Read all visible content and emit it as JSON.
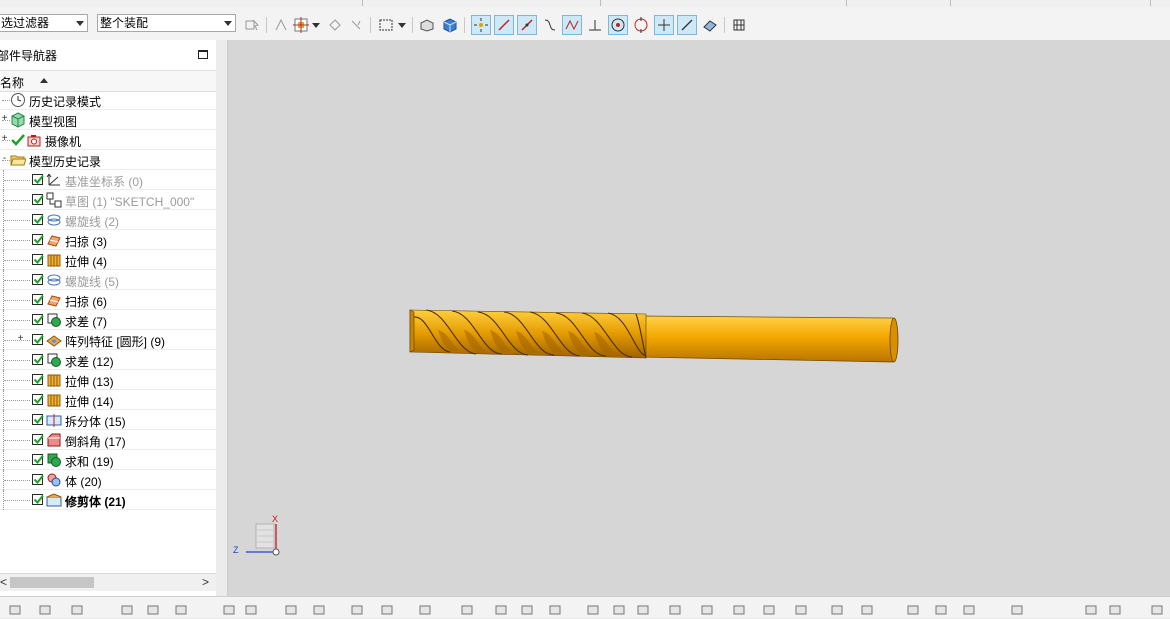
{
  "toolbar": {
    "filter_value": "选过滤器",
    "scope_value": "整个装配",
    "icons": [
      "selection-options-icon",
      "snap-point-icon",
      "dropdown-icon",
      "show-hide-icon",
      "more-icon",
      "select-box-icon",
      "dropdown-icon",
      "shaded-view-icon",
      "solid-view-icon",
      "snap-endpoint-icon",
      "snap-midpoint-icon",
      "snap-control-icon",
      "snap-curve-icon",
      "snap-intersection-icon",
      "snap-perpendicular-icon",
      "snap-center-icon",
      "snap-quadrant-icon",
      "snap-existing-point-icon",
      "snap-on-curve-icon",
      "snap-surface-icon",
      "snap-grid-icon"
    ]
  },
  "navigator": {
    "title": "部件导航器",
    "column_name": "名称",
    "items": [
      {
        "label": "历史记录模式",
        "icon": "clock-icon",
        "level": 0,
        "expander": "",
        "checked": null,
        "dim": false,
        "bold": false
      },
      {
        "label": "模型视图",
        "icon": "model-views-icon",
        "level": 0,
        "expander": "+",
        "checked": null,
        "dim": false,
        "bold": false
      },
      {
        "label": "摄像机",
        "icon": "camera-icon",
        "level": 0,
        "expander": "+",
        "checked": "green",
        "dim": false,
        "bold": false
      },
      {
        "label": "模型历史记录",
        "icon": "folder-open-icon",
        "level": 0,
        "expander": "-",
        "checked": null,
        "dim": false,
        "bold": false
      },
      {
        "label": "基准坐标系 (0)",
        "icon": "datum-csys-icon",
        "level": 1,
        "expander": "",
        "checked": "box",
        "dim": true,
        "bold": false
      },
      {
        "label": "草图 (1) \"SKETCH_000\"",
        "icon": "sketch-icon",
        "level": 1,
        "expander": "",
        "checked": "box",
        "dim": true,
        "bold": false
      },
      {
        "label": "螺旋线 (2)",
        "icon": "helix-icon",
        "level": 1,
        "expander": "",
        "checked": "box",
        "dim": true,
        "bold": false
      },
      {
        "label": "扫掠 (3)",
        "icon": "swept-icon",
        "level": 1,
        "expander": "",
        "checked": "box",
        "dim": false,
        "bold": false
      },
      {
        "label": "拉伸 (4)",
        "icon": "extrude-icon",
        "level": 1,
        "expander": "",
        "checked": "box",
        "dim": false,
        "bold": false
      },
      {
        "label": "螺旋线 (5)",
        "icon": "helix-icon",
        "level": 1,
        "expander": "",
        "checked": "box",
        "dim": true,
        "bold": false
      },
      {
        "label": "扫掠 (6)",
        "icon": "swept-icon",
        "level": 1,
        "expander": "",
        "checked": "box",
        "dim": false,
        "bold": false
      },
      {
        "label": "求差 (7)",
        "icon": "subtract-icon",
        "level": 1,
        "expander": "",
        "checked": "box",
        "dim": false,
        "bold": false
      },
      {
        "label": "阵列特征 [圆形] (9)",
        "icon": "pattern-feature-icon",
        "level": 1,
        "expander": "+",
        "checked": "box",
        "dim": false,
        "bold": false
      },
      {
        "label": "求差 (12)",
        "icon": "subtract-icon",
        "level": 1,
        "expander": "",
        "checked": "box",
        "dim": false,
        "bold": false
      },
      {
        "label": "拉伸 (13)",
        "icon": "extrude-icon",
        "level": 1,
        "expander": "",
        "checked": "box",
        "dim": false,
        "bold": false
      },
      {
        "label": "拉伸 (14)",
        "icon": "extrude-icon",
        "level": 1,
        "expander": "",
        "checked": "box",
        "dim": false,
        "bold": false
      },
      {
        "label": "拆分体 (15)",
        "icon": "split-body-icon",
        "level": 1,
        "expander": "",
        "checked": "box",
        "dim": false,
        "bold": false
      },
      {
        "label": "倒斜角 (17)",
        "icon": "chamfer-icon",
        "level": 1,
        "expander": "",
        "checked": "box",
        "dim": false,
        "bold": false
      },
      {
        "label": "求和 (19)",
        "icon": "unite-icon",
        "level": 1,
        "expander": "",
        "checked": "box",
        "dim": false,
        "bold": false
      },
      {
        "label": "体 (20)",
        "icon": "body-icon",
        "level": 1,
        "expander": "",
        "checked": "box",
        "dim": false,
        "bold": false
      },
      {
        "label": "修剪体 (21)",
        "icon": "trim-body-icon",
        "level": 1,
        "expander": "",
        "checked": "box",
        "dim": false,
        "bold": true
      }
    ]
  },
  "viewport": {
    "model_color": "#f5a800",
    "background_color": "#d6d6d6",
    "triad": {
      "x_label": "X",
      "z_label": "Z"
    }
  },
  "colors": {
    "check_green": "#22a12a",
    "active_button": "#cde8f6",
    "navigator_bg": "#ffffff"
  }
}
